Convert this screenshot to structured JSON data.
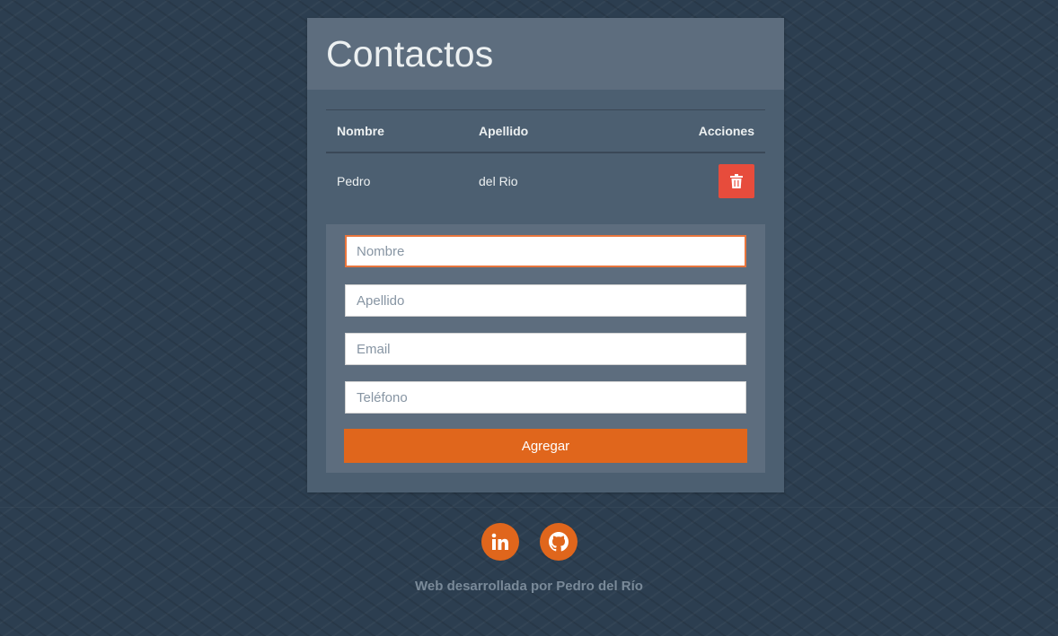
{
  "page": {
    "title": "Contactos"
  },
  "table": {
    "headers": {
      "first_name": "Nombre",
      "last_name": "Apellido",
      "actions": "Acciones"
    },
    "rows": [
      {
        "first_name": "Pedro",
        "last_name": "del Rio",
        "action_icon": "trash-icon"
      }
    ]
  },
  "form": {
    "first_name": {
      "value": "",
      "placeholder": "Nombre"
    },
    "last_name": {
      "value": "",
      "placeholder": "Apellido"
    },
    "email": {
      "value": "",
      "placeholder": "Email"
    },
    "phone": {
      "value": "",
      "placeholder": "Teléfono"
    },
    "submit_label": "Agregar"
  },
  "footer": {
    "social": [
      {
        "icon": "linkedin-icon"
      },
      {
        "icon": "github-icon"
      }
    ],
    "credit": "Web desarrollada por Pedro del Río"
  },
  "colors": {
    "background": "#2c3e50",
    "card": "#4c5f71",
    "accent": "#e0661c",
    "danger": "#e74c3c"
  }
}
